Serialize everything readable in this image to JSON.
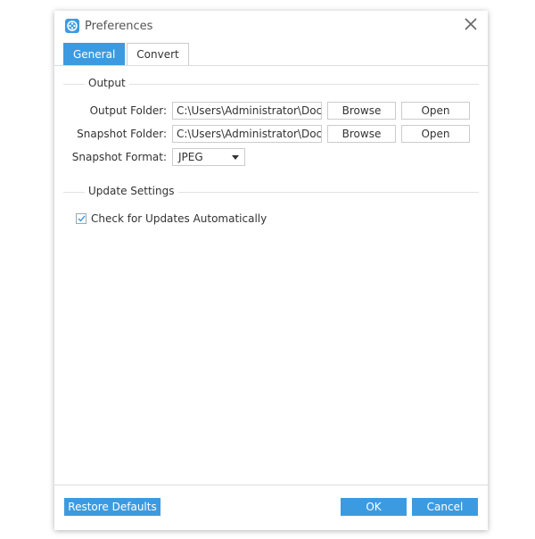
{
  "window": {
    "title": "Preferences",
    "accent": "#3c9be0"
  },
  "tabs": [
    {
      "label": "General",
      "active": true
    },
    {
      "label": "Convert",
      "active": false
    }
  ],
  "output": {
    "section": "Output",
    "output_folder": {
      "label": "Output Folder:",
      "value": "C:\\Users\\Administrator\\Doc",
      "browse": "Browse",
      "open": "Open"
    },
    "snapshot_folder": {
      "label": "Snapshot Folder:",
      "value": "C:\\Users\\Administrator\\Doc",
      "browse": "Browse",
      "open": "Open"
    },
    "snapshot_format": {
      "label": "Snapshot Format:",
      "value": "JPEG"
    }
  },
  "update": {
    "section": "Update Settings",
    "auto_check": {
      "label": "Check for Updates Automatically",
      "checked": true
    }
  },
  "footer": {
    "restore": "Restore Defaults",
    "ok": "OK",
    "cancel": "Cancel"
  }
}
